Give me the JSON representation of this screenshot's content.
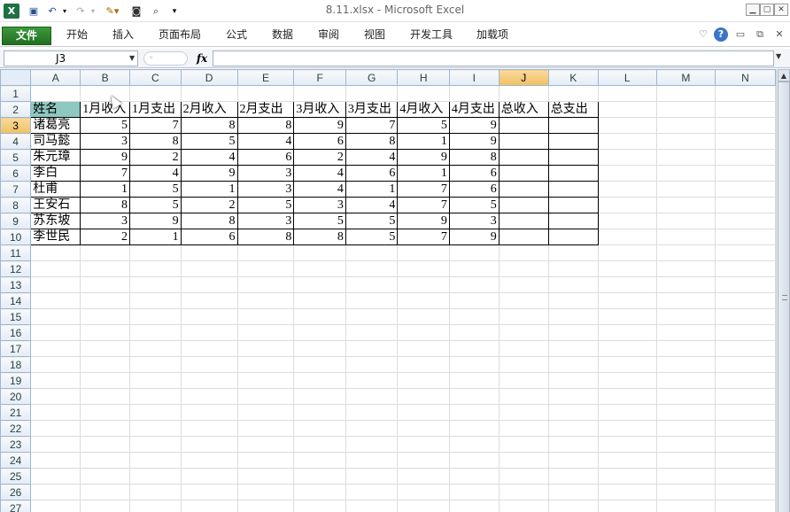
{
  "titlebar": {
    "title": "8.11.xlsx  -  Microsoft Excel",
    "quick_access": [
      "excel-logo-icon",
      "save-icon",
      "undo-icon",
      "undo-dropdown-icon",
      "redo-icon",
      "redo-dropdown-icon",
      "format-icon",
      "camera-icon",
      "print-preview-icon",
      "customize-qa-icon"
    ],
    "window_buttons": [
      "minimize",
      "restore",
      "close"
    ]
  },
  "ribbon": {
    "tabs": [
      "文件",
      "开始",
      "插入",
      "页面布局",
      "公式",
      "数据",
      "审阅",
      "视图",
      "开发工具",
      "加载项"
    ],
    "right_icons": [
      "minimize-ribbon-icon",
      "help-icon",
      "doc-minimize-icon",
      "doc-restore-icon",
      "doc-close-icon"
    ],
    "help_glyph": "?"
  },
  "formula_bar": {
    "name_box": "J3",
    "fx_label": "fx",
    "formula": ""
  },
  "sheet": {
    "selected_cell": "J3",
    "columns": [
      "A",
      "B",
      "C",
      "D",
      "E",
      "F",
      "G",
      "H",
      "I",
      "J",
      "K",
      "L",
      "M",
      "N"
    ],
    "rows": [
      "1",
      "2",
      "3",
      "4",
      "5",
      "6",
      "7",
      "8",
      "9",
      "10",
      "11",
      "12",
      "13",
      "14",
      "15",
      "16",
      "17",
      "18",
      "19",
      "20",
      "21",
      "22",
      "23",
      "24",
      "25",
      "26",
      "27"
    ],
    "header_row": [
      "姓名",
      "1月收入",
      "1月支出",
      "2月收入",
      "2月支出",
      "3月收入",
      "3月支出",
      "4月收入",
      "4月支出",
      "总收入",
      "总支出"
    ],
    "data": [
      [
        "诸葛亮",
        "5",
        "7",
        "8",
        "8",
        "9",
        "7",
        "5",
        "9",
        "",
        ""
      ],
      [
        "司马懿",
        "3",
        "8",
        "5",
        "4",
        "6",
        "8",
        "1",
        "9",
        "",
        ""
      ],
      [
        "朱元璋",
        "9",
        "2",
        "4",
        "6",
        "2",
        "4",
        "9",
        "8",
        "",
        ""
      ],
      [
        "李白",
        "7",
        "4",
        "9",
        "3",
        "4",
        "6",
        "1",
        "6",
        "",
        ""
      ],
      [
        "杜甫",
        "1",
        "5",
        "1",
        "3",
        "4",
        "1",
        "7",
        "6",
        "",
        ""
      ],
      [
        "王安石",
        "8",
        "5",
        "2",
        "5",
        "3",
        "4",
        "7",
        "5",
        "",
        ""
      ],
      [
        "苏东坡",
        "3",
        "9",
        "8",
        "3",
        "5",
        "5",
        "9",
        "3",
        "",
        ""
      ],
      [
        "李世民",
        "2",
        "1",
        "6",
        "8",
        "8",
        "5",
        "7",
        "9",
        "",
        ""
      ]
    ]
  },
  "colors": {
    "file_tab": "#2c7c2c",
    "name_header_fill": "#8fc8c0",
    "header_bg": "#e4ecf7"
  }
}
